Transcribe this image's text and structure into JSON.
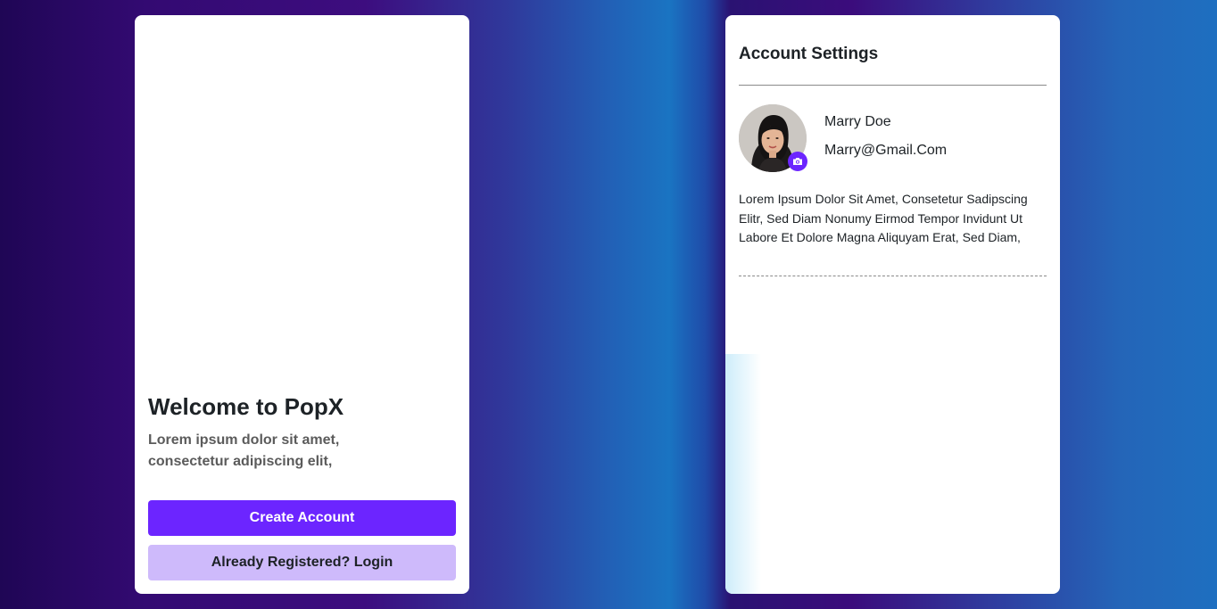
{
  "welcome_screen": {
    "title": "Welcome to PopX",
    "description": "Lorem ipsum dolor sit amet, consectetur adipiscing elit,",
    "create_account_label": "Create Account",
    "login_label": "Already Registered? Login"
  },
  "account_settings": {
    "title": "Account Settings",
    "user": {
      "name": "Marry Doe",
      "email": "Marry@Gmail.Com"
    },
    "bio": "Lorem Ipsum Dolor Sit Amet, Consetetur Sadipscing Elitr, Sed Diam Nonumy Eirmod Tempor Invidunt Ut Labore Et Dolore Magna Aliquyam Erat, Sed Diam,"
  },
  "icons": {
    "avatar_badge": "camera-icon"
  },
  "colors": {
    "accent": "#6C25FF",
    "accent_light": "#CEBAFB",
    "text_dark": "#1D2226",
    "text_muted": "#5B5B5B",
    "card_bg": "#FFFFFF"
  }
}
